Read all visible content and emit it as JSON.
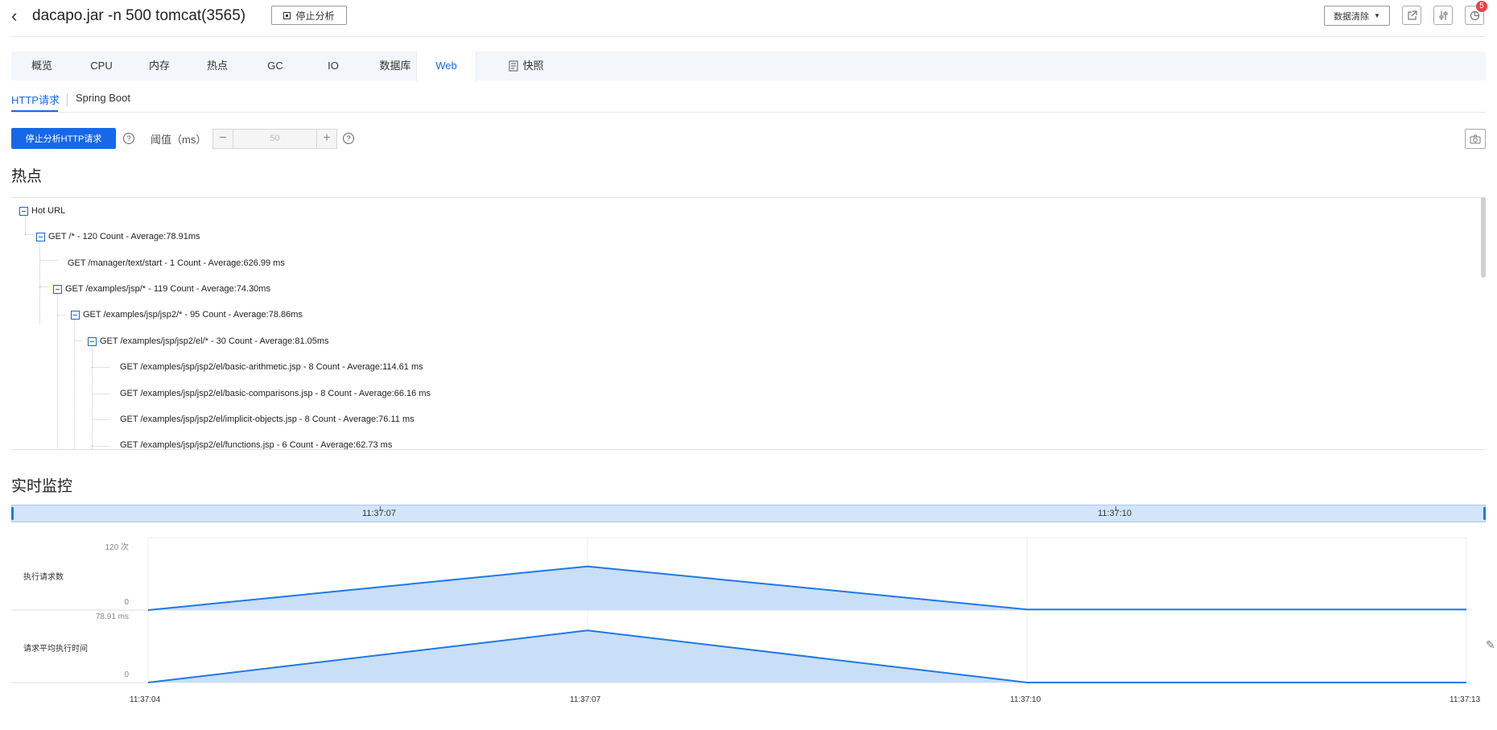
{
  "header": {
    "back_icon": "chevron-left-icon",
    "title": "dacapo.jar -n 500 tomcat(3565)",
    "stop_label": "停止分析",
    "clear_label": "数据清除",
    "badge_count": "5"
  },
  "tabs": [
    "概览",
    "CPU",
    "内存",
    "热点",
    "GC",
    "IO",
    "数据库",
    "Web",
    "快照"
  ],
  "active_tab": "Web",
  "subtabs": [
    "HTTP请求",
    "Spring Boot"
  ],
  "controls": {
    "stop_http_label": "停止分析HTTP请求",
    "threshold_label": "阈值（ms）",
    "threshold_value": "50"
  },
  "hot_section": {
    "title": "热点",
    "nodes": [
      "Hot URL",
      "GET /* - 120 Count - Average:78.91ms",
      "GET /manager/text/start - 1 Count - Average:626.99 ms",
      "GET /examples/jsp/* - 119 Count - Average:74.30ms",
      "GET /examples/jsp/jsp2/* - 95 Count - Average:78.86ms",
      "GET /examples/jsp/jsp2/el/* - 30 Count - Average:81.05ms",
      "GET /examples/jsp/jsp2/el/basic-arithmetic.jsp - 8 Count - Average:114.61 ms",
      "GET /examples/jsp/jsp2/el/basic-comparisons.jsp - 8 Count - Average:66.16 ms",
      "GET /examples/jsp/jsp2/el/implicit-objects.jsp - 8 Count - Average:76.11 ms",
      "GET /examples/jsp/jsp2/el/functions.jsp - 6 Count - Average:62.73 ms"
    ]
  },
  "monitor": {
    "title": "实时监控",
    "range_ticks": [
      "11:37:07",
      "11:37:10"
    ],
    "x_ticks": [
      "11:37:04",
      "11:37:07",
      "11:37:10",
      "11:37:13"
    ]
  },
  "chart_data": [
    {
      "type": "area",
      "ylabel": "执行请求数",
      "y_max_label": "120 次",
      "y_min_label": "0",
      "x": [
        "11:37:04",
        "11:37:07",
        "11:37:10",
        "11:37:13"
      ],
      "values": [
        0,
        74,
        1,
        1
      ],
      "ylim": [
        0,
        120
      ],
      "color": "#1e78e8"
    },
    {
      "type": "area",
      "ylabel": "请求平均执行时间",
      "y_max_label": "78.91 ms",
      "y_min_label": "0",
      "x": [
        "11:37:04",
        "11:37:07",
        "11:37:10",
        "11:37:13"
      ],
      "values": [
        0,
        58.0,
        0,
        0
      ],
      "ylim": [
        0,
        78.91
      ],
      "color": "#1e78e8"
    }
  ]
}
